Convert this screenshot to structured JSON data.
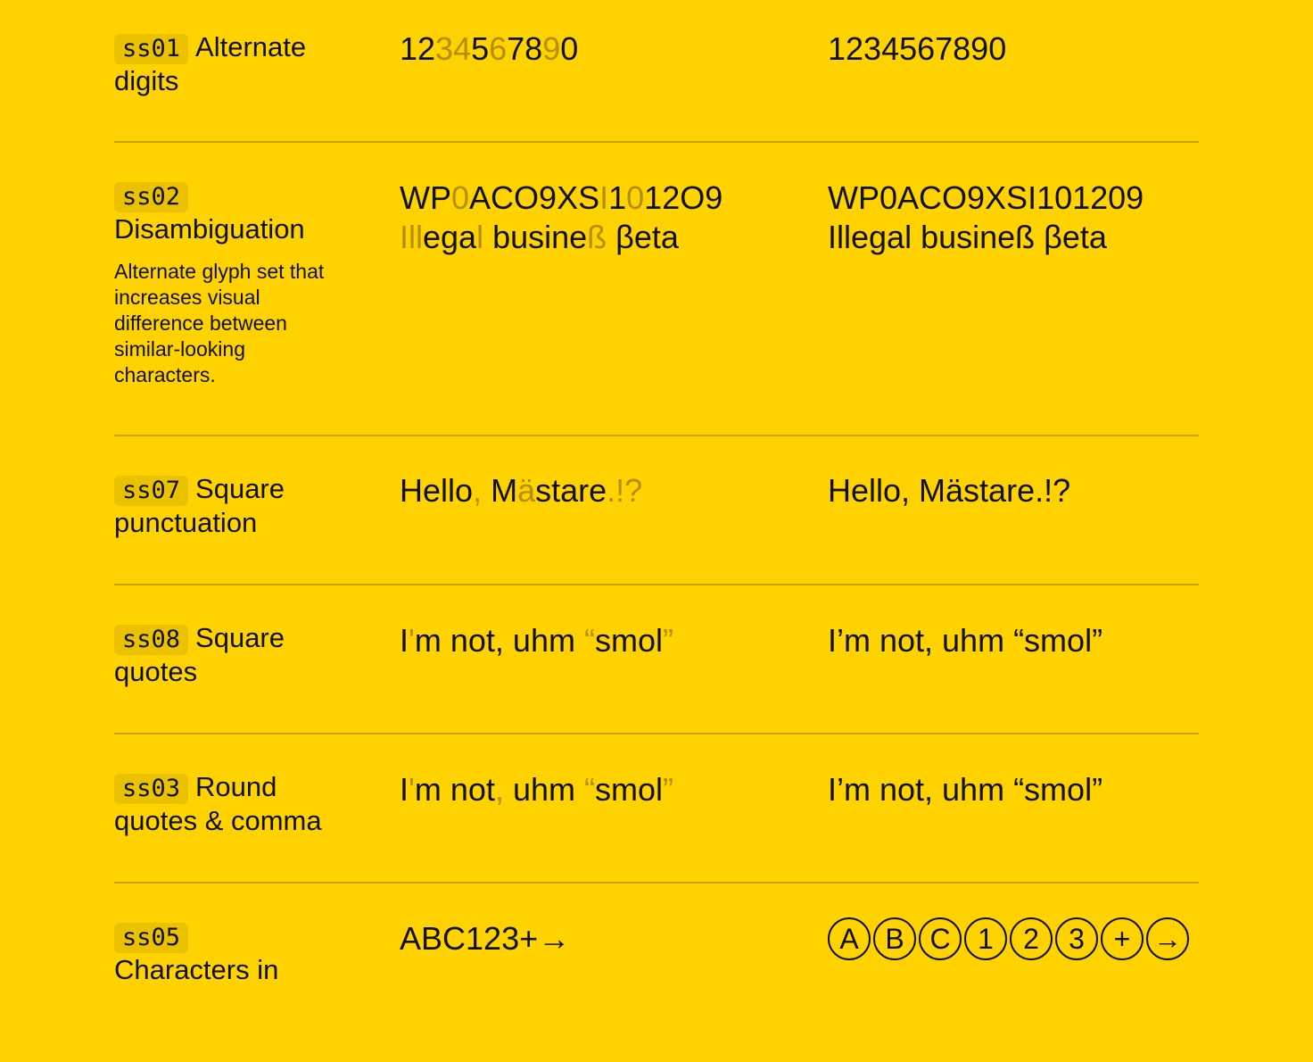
{
  "rows": [
    {
      "code": "ss01",
      "name": "Alternate digits",
      "description": "",
      "on": [
        [
          "12",
          ""
        ],
        [
          "34",
          "hl"
        ],
        [
          "5",
          ""
        ],
        [
          "6",
          "hl"
        ],
        [
          "78",
          ""
        ],
        [
          "9",
          "hl"
        ],
        [
          "0",
          ""
        ]
      ],
      "off": [
        [
          "1234567890",
          ""
        ]
      ]
    },
    {
      "code": "ss02",
      "name": "Disambiguation",
      "description": "Alternate glyph set that increases visual difference between similar-looking characters.",
      "on": [
        [
          "WP",
          ""
        ],
        [
          "0",
          "hl"
        ],
        [
          "ACO9XS",
          ""
        ],
        [
          "I",
          "hl"
        ],
        [
          "1",
          ""
        ],
        [
          "0",
          "hl"
        ],
        [
          "12O9",
          ""
        ],
        [
          "\n",
          ""
        ],
        [
          "Ill",
          "hl"
        ],
        [
          "ega",
          ""
        ],
        [
          "l",
          "hl"
        ],
        [
          " busine",
          ""
        ],
        [
          "ß",
          "hl"
        ],
        [
          " βeta",
          ""
        ]
      ],
      "off": [
        [
          "WP0ACO9XSI101209",
          ""
        ],
        [
          "\n",
          ""
        ],
        [
          "Illegal busineß βeta",
          ""
        ]
      ]
    },
    {
      "code": "ss07",
      "name": "Square punctuation",
      "description": "",
      "on": [
        [
          "Hello",
          ""
        ],
        [
          ",",
          "hl"
        ],
        [
          " M",
          ""
        ],
        [
          "ä",
          "hl"
        ],
        [
          "stare",
          ""
        ],
        [
          ".!?",
          "hl"
        ]
      ],
      "off": [
        [
          "Hello, Mästare.!?",
          ""
        ]
      ]
    },
    {
      "code": "ss08",
      "name": "Square quotes",
      "description": "",
      "on": [
        [
          "I",
          ""
        ],
        [
          "'",
          "hl"
        ],
        [
          "m not, uhm ",
          ""
        ],
        [
          "“",
          "hl"
        ],
        [
          "smol",
          ""
        ],
        [
          "”",
          "hl"
        ]
      ],
      "off": [
        [
          "I’m not, uhm “smol”",
          ""
        ]
      ]
    },
    {
      "code": "ss03",
      "name": "Round quotes & comma",
      "description": "",
      "on": [
        [
          "I",
          ""
        ],
        [
          "'",
          "hl"
        ],
        [
          "m not",
          ""
        ],
        [
          ",",
          "hl"
        ],
        [
          " uhm ",
          ""
        ],
        [
          "“",
          "hl"
        ],
        [
          "smol",
          ""
        ],
        [
          "”",
          "hl"
        ]
      ],
      "off": [
        [
          "I’m not, uhm “smol”",
          ""
        ]
      ]
    },
    {
      "code": "ss05",
      "name": "Characters in",
      "description": "",
      "on": [
        [
          "ABC123+→",
          ""
        ]
      ],
      "off_circled": [
        "A",
        "B",
        "C",
        "1",
        "2",
        "3",
        "+",
        "→"
      ]
    }
  ]
}
